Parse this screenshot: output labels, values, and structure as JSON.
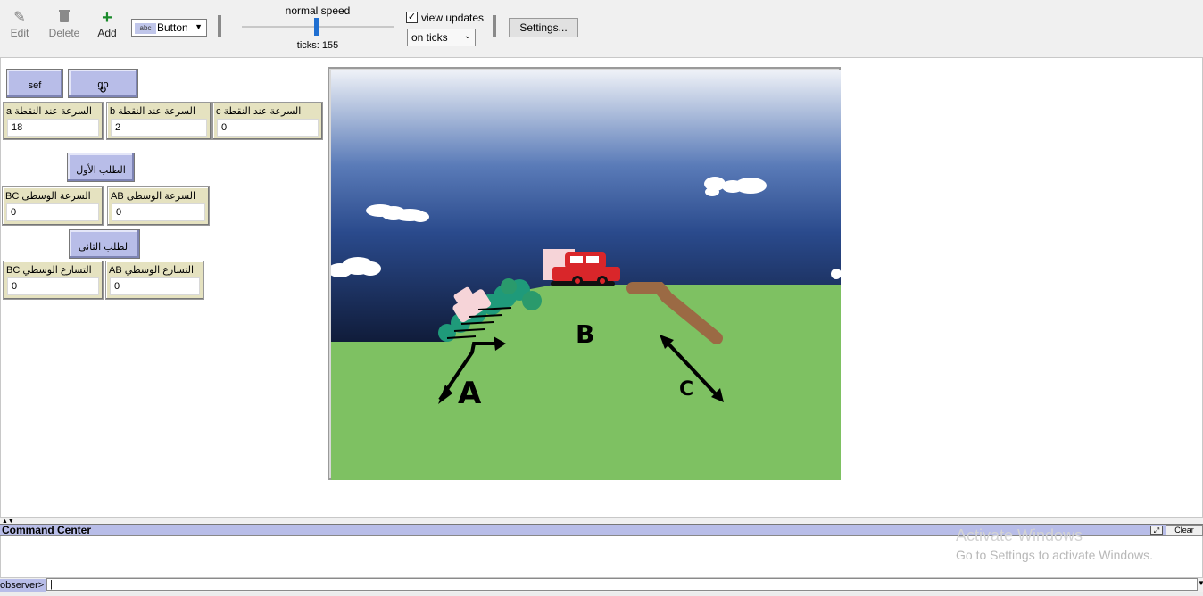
{
  "toolbar": {
    "edit_label": "Edit",
    "delete_label": "Delete",
    "add_label": "Add",
    "widget_select": {
      "badge": "abc",
      "value": "Button"
    },
    "speed_label": "normal speed",
    "ticks_label": "ticks: 155",
    "view_updates_label": "view updates",
    "view_updates_checked": true,
    "update_mode": "on ticks",
    "settings_label": "Settings..."
  },
  "interface": {
    "buttons": {
      "sef": "sef",
      "go": "go",
      "first_request": "الطلب الأول",
      "second_request": "الطلب الثاني"
    },
    "monitors": {
      "speed_a": {
        "label": "a السرعة عند النقطة",
        "value": "18"
      },
      "speed_b": {
        "label": "b السرعة عند النقطة",
        "value": "2"
      },
      "speed_c": {
        "label": "c السرعة عند النقطة",
        "value": "0"
      },
      "avg_speed_bc": {
        "label": "BC السرعة الوسطى",
        "value": "0"
      },
      "avg_speed_ab": {
        "label": "AB السرعة الوسطى",
        "value": "0"
      },
      "avg_accel_bc": {
        "label": "BC التسارع الوسطي",
        "value": "0"
      },
      "avg_accel_ab": {
        "label": "AB التسارع الوسطي",
        "value": "0"
      }
    }
  },
  "world": {
    "labels": {
      "a": "A",
      "b": "B",
      "c": "C"
    },
    "colors": {
      "ground": "#7ec162",
      "sky_top": "#e8ecf4",
      "sky_bottom": "#14224a",
      "car": "#d9262a",
      "ramp": "#9b6a44"
    }
  },
  "command_center": {
    "title": "Command Center",
    "clear_label": "Clear",
    "prompt": "observer>",
    "input_value": "|"
  },
  "watermark": {
    "line1": "Activate Windows",
    "line2": "Go to Settings to activate Windows."
  }
}
